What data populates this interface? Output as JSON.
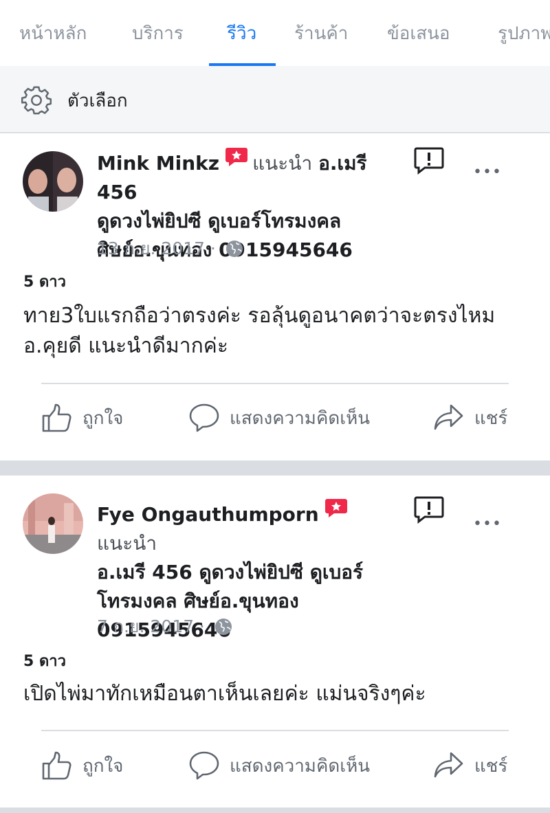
{
  "tabs": [
    {
      "label": "หน้าหลัก",
      "active": false
    },
    {
      "label": "บริการ",
      "active": false
    },
    {
      "label": "รีวิว",
      "active": true
    },
    {
      "label": "ร้านค้า",
      "active": false
    },
    {
      "label": "ข้อเสนอ",
      "active": false
    },
    {
      "label": "รูปภาพ",
      "active": false
    }
  ],
  "options": {
    "label": "ตัวเลือก"
  },
  "reviews": [
    {
      "author": "Mink Minkz",
      "verb": "แนะนำ",
      "page_line1": "อ.เมรี 456",
      "page_line2": "ดูดวงไพ่ยิปซี ดูเบอร์โทรมงคล",
      "page_line3": "ศิษย์อ.ขุนทอง 0915945646",
      "date": "13 ก.ย. 2017 ·",
      "rating": "5 ดาว",
      "text": "ทาย3ใบแรกถือว่าตรงค่ะ รอลุ้นดูอนาคตว่าจะตรงไหม อ.คุยดี แนะนำดีมากค่ะ",
      "more": "•••"
    },
    {
      "author": "Fye Ongauthumporn",
      "verb": "แนะนำ",
      "page_line1": "อ.เมรี 456 ดูดวงไพ่ยิปซี ดูเบอร์",
      "page_line2": "โทรมงคล ศิษย์อ.ขุนทอง",
      "page_line3": "0915945646",
      "date": "7 ก.ย. 2017 ·",
      "rating": "5 ดาว",
      "text": "เปิดไพ่มาทักเหมือนตาเห็นเลยค่ะ แม่นจริงๆค่ะ",
      "more": "•••"
    }
  ],
  "actions": {
    "like": "ถูกใจ",
    "comment": "แสดงความคิดเห็น",
    "share": "แชร์"
  },
  "colors": {
    "accent": "#1877f2",
    "badge": "#f02849",
    "text": "#1c1e21",
    "muted": "#606770"
  }
}
